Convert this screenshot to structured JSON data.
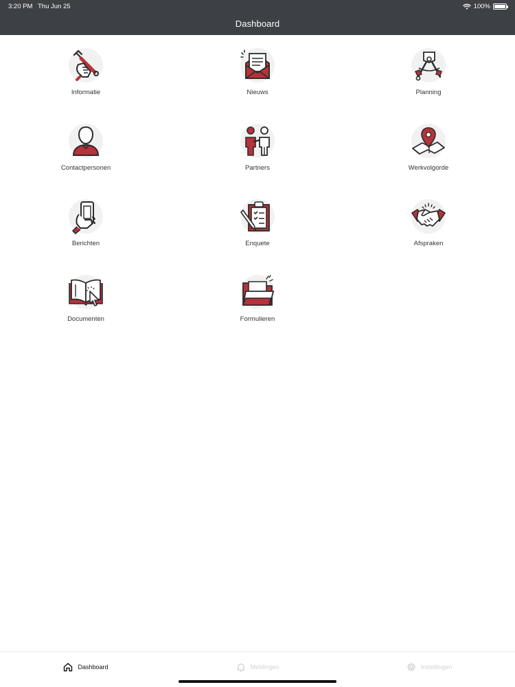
{
  "status_bar": {
    "time": "3:20 PM",
    "date": "Thu Jun 25",
    "battery": "100%"
  },
  "header": {
    "title": "Dashboard"
  },
  "tiles": [
    {
      "label": "Informatie",
      "icon": "wrench-hand-icon"
    },
    {
      "label": "Nieuws",
      "icon": "newsletter-envelope-icon"
    },
    {
      "label": "Planning",
      "icon": "compass-drawing-icon"
    },
    {
      "label": "Contactpersonen",
      "icon": "person-icon"
    },
    {
      "label": "Partners",
      "icon": "partners-icon"
    },
    {
      "label": "Werkvolgorde",
      "icon": "map-pin-icon"
    },
    {
      "label": "Berichten",
      "icon": "phone-hand-icon"
    },
    {
      "label": "Enquete",
      "icon": "clipboard-checklist-icon"
    },
    {
      "label": "Afspraken",
      "icon": "handshake-icon"
    },
    {
      "label": "Documenten",
      "icon": "book-cursor-icon"
    },
    {
      "label": "Formulieren",
      "icon": "folder-icon"
    }
  ],
  "tabbar": {
    "dashboard": "Dashboard",
    "notifications": "Meldingen",
    "settings": "Instellingen"
  },
  "colors": {
    "header_bg": "#3d4045",
    "accent": "#b7323a",
    "icon_stroke": "#2b2b2b",
    "inactive_tab": "#d2d2d2"
  }
}
